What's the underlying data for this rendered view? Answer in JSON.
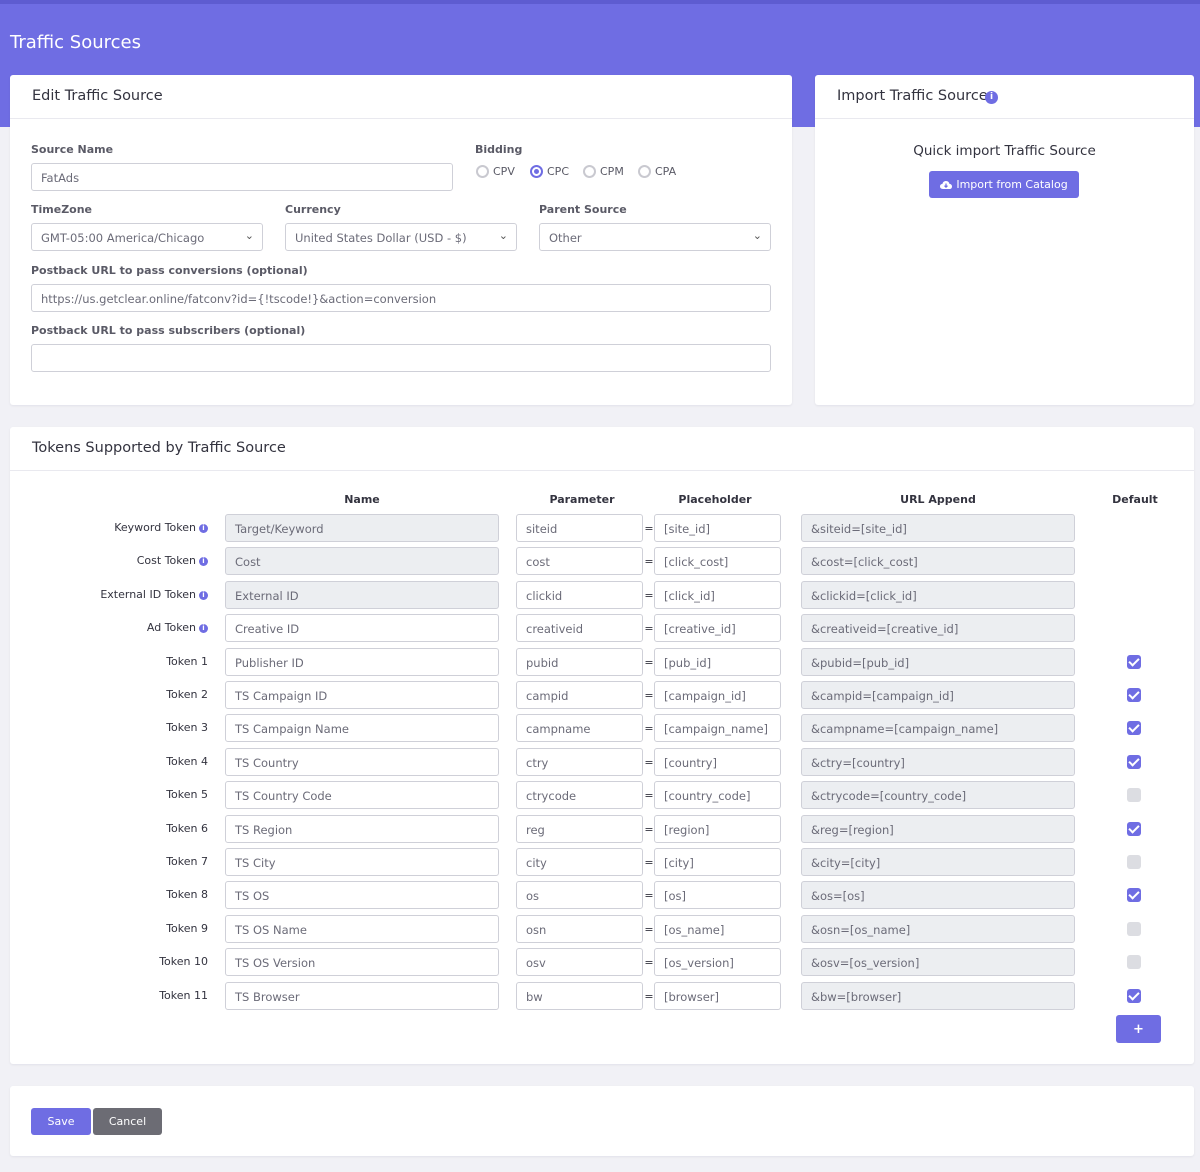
{
  "page": {
    "title": "Traffic Sources"
  },
  "colors": {
    "accent": "#6f6de3",
    "secondary": "#6c6c74"
  },
  "edit": {
    "title": "Edit Traffic Source",
    "source_name_label": "Source Name",
    "source_name_value": "FatAds",
    "bidding_label": "Bidding",
    "bidding_options": [
      "CPV",
      "CPC",
      "CPM",
      "CPA"
    ],
    "bidding_selected": "CPC",
    "timezone_label": "TimeZone",
    "timezone_value": "GMT-05:00 America/Chicago",
    "currency_label": "Currency",
    "currency_value": "United States Dollar (USD - $)",
    "parent_label": "Parent Source",
    "parent_value": "Other",
    "postback_conv_label": "Postback URL to pass conversions (optional)",
    "postback_conv_value": "https://us.getclear.online/fatconv?id={!tscode!}&action=conversion",
    "postback_sub_label": "Postback URL to pass subscribers (optional)",
    "postback_sub_value": ""
  },
  "import": {
    "title": "Import Traffic Source",
    "info_icon": "info-circle-icon",
    "subtitle": "Quick import Traffic Source",
    "button_label": "Import from Catalog",
    "button_icon": "cloud-download-icon"
  },
  "tokens": {
    "title": "Tokens Supported by Traffic Source",
    "headers": {
      "name": "Name",
      "parameter": "Parameter",
      "placeholder": "Placeholder",
      "url_append": "URL Append",
      "default": "Default"
    },
    "equals": "=",
    "add_label": "+",
    "rows": [
      {
        "label": "Keyword Token",
        "info": true,
        "name": "Target/Keyword",
        "param": "siteid",
        "placeholder": "[site_id]",
        "append": "&siteid=[site_id]",
        "name_readonly": true,
        "default": null
      },
      {
        "label": "Cost Token",
        "info": true,
        "name": "Cost",
        "param": "cost",
        "placeholder": "[click_cost]",
        "append": "&cost=[click_cost]",
        "name_readonly": true,
        "default": null
      },
      {
        "label": "External ID Token",
        "info": true,
        "name": "External ID",
        "param": "clickid",
        "placeholder": "[click_id]",
        "append": "&clickid=[click_id]",
        "name_readonly": true,
        "default": null
      },
      {
        "label": "Ad Token",
        "info": true,
        "name": "Creative ID",
        "param": "creativeid",
        "placeholder": "[creative_id]",
        "append": "&creativeid=[creative_id]",
        "name_readonly": false,
        "default": null
      },
      {
        "label": "Token 1",
        "info": false,
        "name": "Publisher ID",
        "param": "pubid",
        "placeholder": "[pub_id]",
        "append": "&pubid=[pub_id]",
        "name_readonly": false,
        "default": true
      },
      {
        "label": "Token 2",
        "info": false,
        "name": "TS Campaign ID",
        "param": "campid",
        "placeholder": "[campaign_id]",
        "append": "&campid=[campaign_id]",
        "name_readonly": false,
        "default": true
      },
      {
        "label": "Token 3",
        "info": false,
        "name": "TS Campaign Name",
        "param": "campname",
        "placeholder": "[campaign_name]",
        "append": "&campname=[campaign_name]",
        "name_readonly": false,
        "default": true
      },
      {
        "label": "Token 4",
        "info": false,
        "name": "TS Country",
        "param": "ctry",
        "placeholder": "[country]",
        "append": "&ctry=[country]",
        "name_readonly": false,
        "default": true
      },
      {
        "label": "Token 5",
        "info": false,
        "name": "TS Country Code",
        "param": "ctrycode",
        "placeholder": "[country_code]",
        "append": "&ctrycode=[country_code]",
        "name_readonly": false,
        "default": false
      },
      {
        "label": "Token 6",
        "info": false,
        "name": "TS Region",
        "param": "reg",
        "placeholder": "[region]",
        "append": "&reg=[region]",
        "name_readonly": false,
        "default": true
      },
      {
        "label": "Token 7",
        "info": false,
        "name": "TS City",
        "param": "city",
        "placeholder": "[city]",
        "append": "&city=[city]",
        "name_readonly": false,
        "default": false
      },
      {
        "label": "Token 8",
        "info": false,
        "name": "TS OS",
        "param": "os",
        "placeholder": "[os]",
        "append": "&os=[os]",
        "name_readonly": false,
        "default": true
      },
      {
        "label": "Token 9",
        "info": false,
        "name": "TS OS Name",
        "param": "osn",
        "placeholder": "[os_name]",
        "append": "&osn=[os_name]",
        "name_readonly": false,
        "default": false
      },
      {
        "label": "Token 10",
        "info": false,
        "name": "TS OS Version",
        "param": "osv",
        "placeholder": "[os_version]",
        "append": "&osv=[os_version]",
        "name_readonly": false,
        "default": false
      },
      {
        "label": "Token 11",
        "info": false,
        "name": "TS Browser",
        "param": "bw",
        "placeholder": "[browser]",
        "append": "&bw=[browser]",
        "name_readonly": false,
        "default": true
      }
    ]
  },
  "actions": {
    "save_label": "Save",
    "cancel_label": "Cancel"
  }
}
